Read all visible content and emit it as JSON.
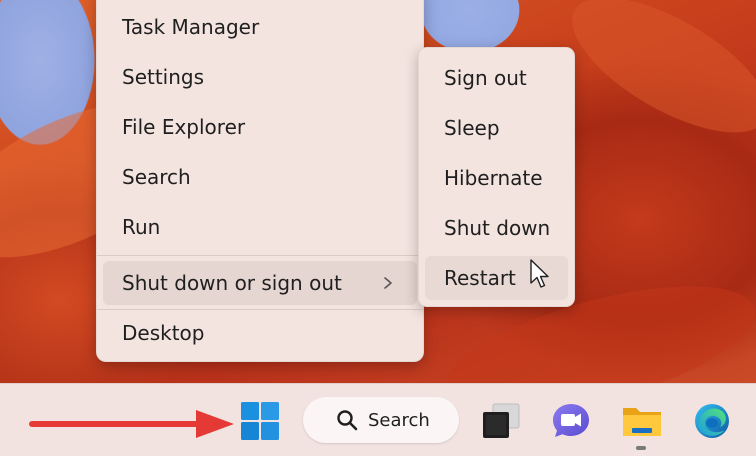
{
  "context_menu": {
    "items": [
      {
        "label": "Task Manager"
      },
      {
        "label": "Settings"
      },
      {
        "label": "File Explorer"
      },
      {
        "label": "Search"
      },
      {
        "label": "Run"
      },
      {
        "label": "Shut down or sign out"
      },
      {
        "label": "Desktop"
      }
    ]
  },
  "submenu": {
    "items": [
      {
        "label": "Sign out"
      },
      {
        "label": "Sleep"
      },
      {
        "label": "Hibernate"
      },
      {
        "label": "Shut down"
      },
      {
        "label": "Restart"
      }
    ]
  },
  "taskbar": {
    "search_label": "Search",
    "icons": [
      "windows-start-icon",
      "search-icon",
      "task-view-icon",
      "teams-chat-icon",
      "file-explorer-icon",
      "edge-browser-icon"
    ]
  },
  "colors": {
    "menu_background": "#f3e4df",
    "taskbar_background": "#f2e3e1",
    "annotation_arrow": "#e53935",
    "windows_blue": "#1b8fe0"
  }
}
